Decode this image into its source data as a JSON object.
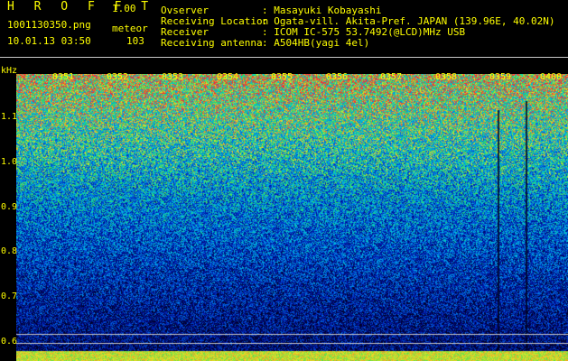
{
  "header": {
    "app_title": "H R O F F T",
    "version": "1.00",
    "filename": "1001130350.png",
    "timestamp": "10.01.13 03:50",
    "mode_label": "meteor",
    "count": "103"
  },
  "info": {
    "labels": [
      "Ovserver",
      "Receiving Location",
      "Receiver",
      "Receiving antenna"
    ],
    "values": [
      ": Masayuki Kobayashi",
      ": Ogata-vill. Akita-Pref. JAPAN (139.96E, 40.02N)",
      ": ICOM IC-575 53.7492(@LCD)MHz USB",
      ": A504HB(yagi 4el)"
    ]
  },
  "spectrogram": {
    "y_unit": "kHz",
    "y_ticks": [
      "1.1",
      "1.0",
      "0.9",
      "0.8",
      "0.7",
      "0.6"
    ],
    "x_ticks": [
      "0351",
      "0352",
      "0353",
      "0354",
      "0355",
      "0356",
      "0357",
      "0358",
      "0359",
      "0400"
    ]
  },
  "colors": {
    "text": "#ffff00",
    "background": "#000000",
    "divider": "#c8c8c8"
  }
}
